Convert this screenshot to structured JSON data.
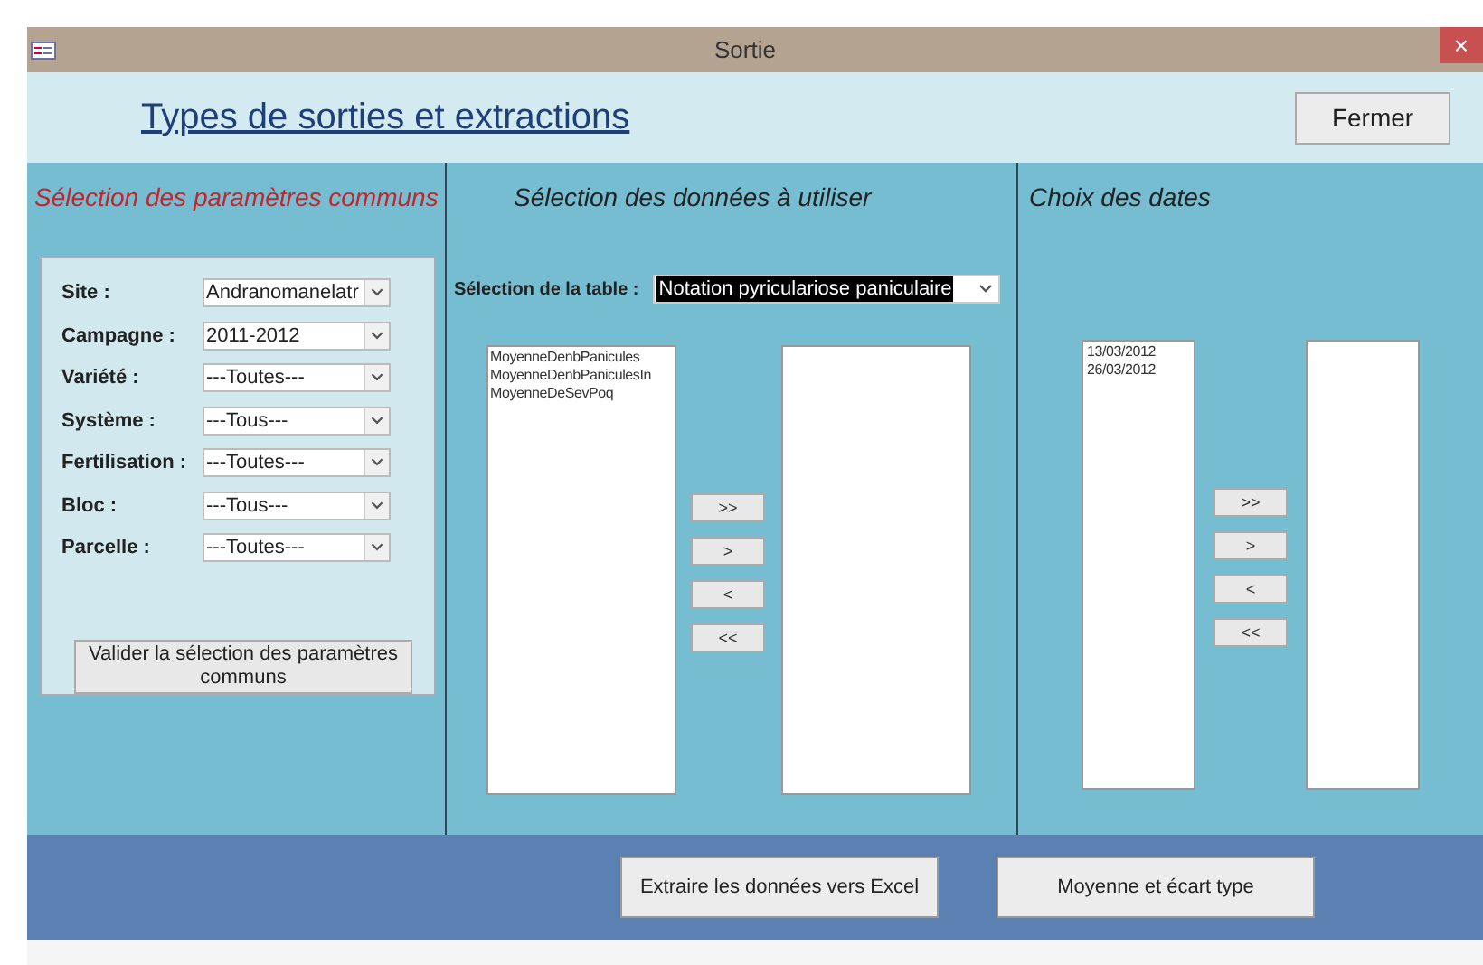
{
  "window": {
    "title": "Sortie",
    "close": "×"
  },
  "header": {
    "title": "Types de sorties et extractions",
    "close_button": "Fermer"
  },
  "common": {
    "heading": "Sélection des paramètres communs",
    "fields": [
      {
        "label": "Site :",
        "value": "Andranomanelatr"
      },
      {
        "label": "Campagne :",
        "value": "2011-2012"
      },
      {
        "label": "Variété :",
        "value": "---Toutes---"
      },
      {
        "label": "Système :",
        "value": "---Tous---"
      },
      {
        "label": "Fertilisation :",
        "value": "---Toutes---"
      },
      {
        "label": "Bloc :",
        "value": "---Tous---"
      },
      {
        "label": "Parcelle :",
        "value": "---Toutes---"
      }
    ],
    "validate_button": "Valider la sélection des paramètres communs"
  },
  "data": {
    "heading": "Sélection des données à utiliser",
    "table_label": "Sélection de la table :",
    "table_value": "Notation pyriculariose paniculaire",
    "available": [
      "MoyenneDenbPanicules",
      "MoyenneDenbPaniculesIn",
      "MoyenneDeSevPoq"
    ],
    "move_buttons": [
      ">>",
      ">",
      "<",
      "<<"
    ]
  },
  "dates": {
    "heading": "Choix des dates",
    "available": [
      "13/03/2012",
      "26/03/2012"
    ],
    "move_buttons": [
      ">>",
      ">",
      "<",
      "<<"
    ]
  },
  "footer": {
    "buttons": [
      "Extraire les données vers Excel",
      "Moyenne et écart type"
    ]
  }
}
